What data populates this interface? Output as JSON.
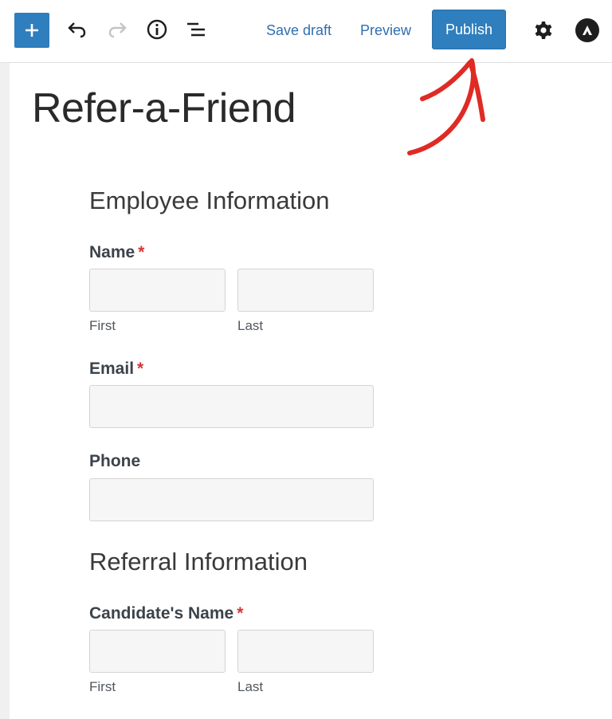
{
  "toolbar": {
    "inserter_icon": "plus-icon",
    "undo_icon": "undo-icon",
    "redo_icon": "redo-icon",
    "info_icon": "info-icon",
    "outline_icon": "list-view-icon",
    "save_draft_label": "Save draft",
    "preview_label": "Preview",
    "publish_label": "Publish",
    "settings_icon": "gear-icon",
    "theme_icon": "astra-logo-icon"
  },
  "colors": {
    "accent": "#2f7ebd",
    "link": "#2f6fb0",
    "required": "#d63638",
    "annotation_arrow": "#e02a24"
  },
  "post": {
    "title": "Refer-a-Friend"
  },
  "form": {
    "employee_section": "Employee Information",
    "name_label": "Name",
    "required_mark": "*",
    "first_sublabel": "First",
    "last_sublabel": "Last",
    "email_label": "Email",
    "phone_label": "Phone",
    "referral_section": "Referral Information",
    "candidate_name_label": "Candidate's Name"
  }
}
